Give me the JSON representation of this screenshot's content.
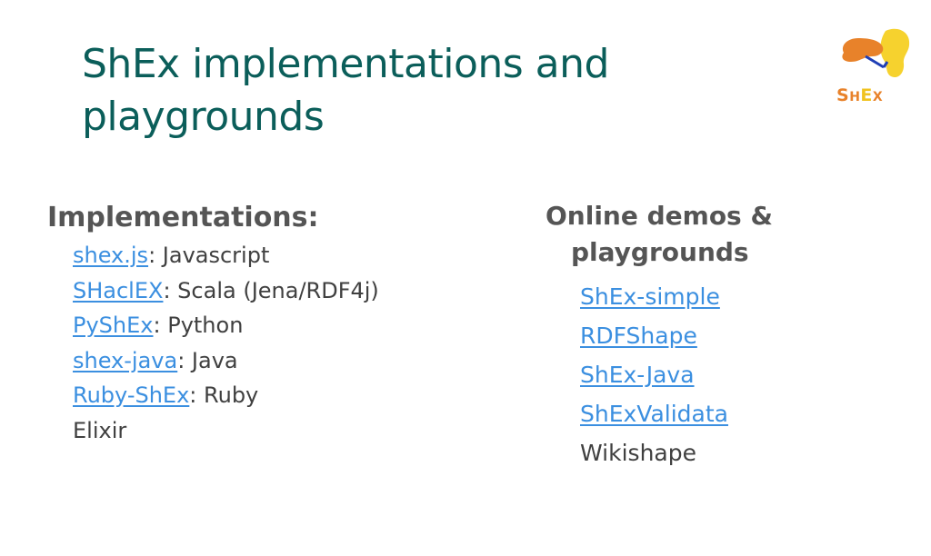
{
  "slide": {
    "title_line1": "ShEx implementations and",
    "title_line2": "playgrounds"
  },
  "logo": {
    "icon": "shex-logo-icon",
    "word_part1": "S",
    "word_part2": "H",
    "word_part3": "E",
    "word_part4": "X",
    "colors": {
      "orange": "#e8822a",
      "yellow": "#f6d22e",
      "blue": "#1f3fb5"
    }
  },
  "implementations": {
    "heading": "Implementations:",
    "items": [
      {
        "link": "shex.js",
        "text": ": Javascript"
      },
      {
        "link": "SHaclEX",
        "text": ": Scala (Jena/RDF4j)"
      },
      {
        "link": "PyShEx",
        "text": ": Python"
      },
      {
        "link": "shex-java",
        "text": ": Java"
      },
      {
        "link": "Ruby-ShEx",
        "text": ": Ruby"
      },
      {
        "link": "",
        "text": "Elixir"
      }
    ]
  },
  "demos": {
    "heading_line1": "Online demos &",
    "heading_line2": "playgrounds",
    "items": [
      {
        "link": "ShEx-simple"
      },
      {
        "link": "RDFShape"
      },
      {
        "link": "ShEx-Java"
      },
      {
        "link": "ShExValidata"
      },
      {
        "text": "Wikishape"
      }
    ]
  },
  "colors": {
    "title": "#0b5e5a",
    "link": "#3b8fe0",
    "body_text": "#404040"
  }
}
